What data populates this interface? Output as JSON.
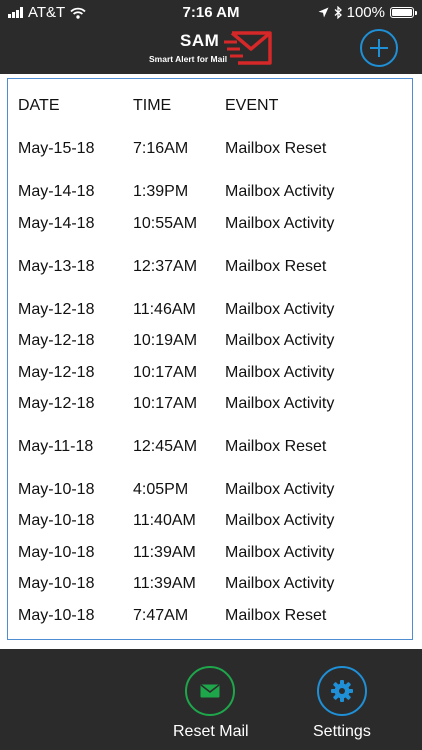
{
  "status_bar": {
    "carrier": "AT&T",
    "time": "7:16 AM",
    "battery": "100%"
  },
  "header": {
    "logo_title": "SAM",
    "logo_subtitle": "Smart Alert for Mail",
    "add_icon": "plus-icon"
  },
  "table": {
    "headers": [
      "DATE",
      "TIME",
      "EVENT"
    ],
    "rows": [
      [
        "May-15-18",
        "7:16AM",
        "Mailbox Reset"
      ],
      [
        "May-14-18",
        "1:39PM",
        "Mailbox Activity"
      ],
      [
        "May-14-18",
        "10:55AM",
        "Mailbox Activity"
      ],
      [
        "May-13-18",
        "12:37AM",
        "Mailbox Reset"
      ],
      [
        "May-12-18",
        "11:46AM",
        "Mailbox Activity"
      ],
      [
        "May-12-18",
        "10:19AM",
        "Mailbox Activity"
      ],
      [
        "May-12-18",
        "10:17AM",
        "Mailbox Activity"
      ],
      [
        "May-12-18",
        "10:17AM",
        "Mailbox Activity"
      ],
      [
        "May-11-18",
        "12:45AM",
        "Mailbox Reset"
      ],
      [
        "May-10-18",
        "4:05PM",
        "Mailbox Activity"
      ],
      [
        "May-10-18",
        "11:40AM",
        "Mailbox Activity"
      ],
      [
        "May-10-18",
        "11:39AM",
        "Mailbox Activity"
      ],
      [
        "May-10-18",
        "11:39AM",
        "Mailbox Activity"
      ],
      [
        "May-10-18",
        "7:47AM",
        "Mailbox Reset"
      ]
    ]
  },
  "bottom_bar": {
    "reset_label": "Reset Mail",
    "settings_label": "Settings"
  },
  "colors": {
    "accent_blue": "#1f8fd6",
    "accent_green": "#1ea64b",
    "logo_red": "#d62828",
    "bar_bg": "#2b2b2b"
  }
}
